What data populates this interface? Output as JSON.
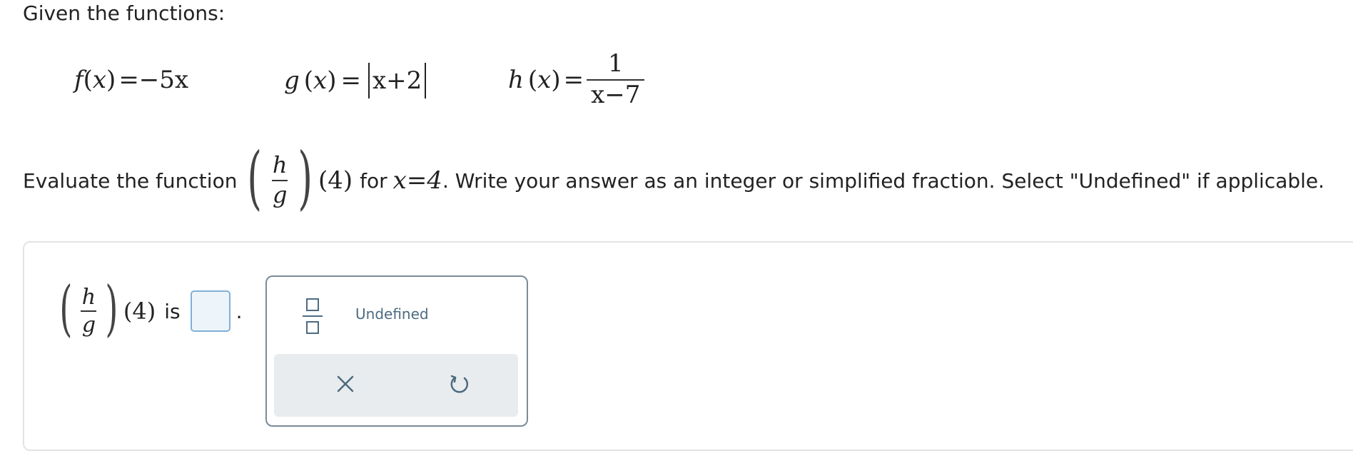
{
  "intro_text": "Given the functions:",
  "functions": {
    "f": {
      "name": "f",
      "var": "x",
      "expr": "=−5x"
    },
    "g": {
      "name": "g",
      "var": "x",
      "inner": "x+2"
    },
    "h": {
      "name": "h",
      "var": "x",
      "numerator": "1",
      "denominator": "x−7"
    }
  },
  "prompt": {
    "before": "Evaluate the function",
    "frac_num": "h",
    "frac_den": "g",
    "arg": "(4)",
    "for_word": "for",
    "condition": "x=4",
    "after": ". Write your answer as an integer or simplified fraction. Select \"Undefined\" if applicable."
  },
  "answer": {
    "frac_num": "h",
    "frac_den": "g",
    "arg": "(4)",
    "is_word": "is",
    "value": "",
    "period": "."
  },
  "toolbar": {
    "undefined_label": "Undefined"
  },
  "icons": {
    "fraction": "fraction-icon",
    "clear": "close-icon",
    "undo": "undo-icon"
  },
  "colors": {
    "input_border": "#7fb0d8",
    "input_fill": "#eef5fa",
    "tool_text": "#4d6b80",
    "popup_border": "#7a8c99",
    "footer_bg": "#e9ecee"
  }
}
